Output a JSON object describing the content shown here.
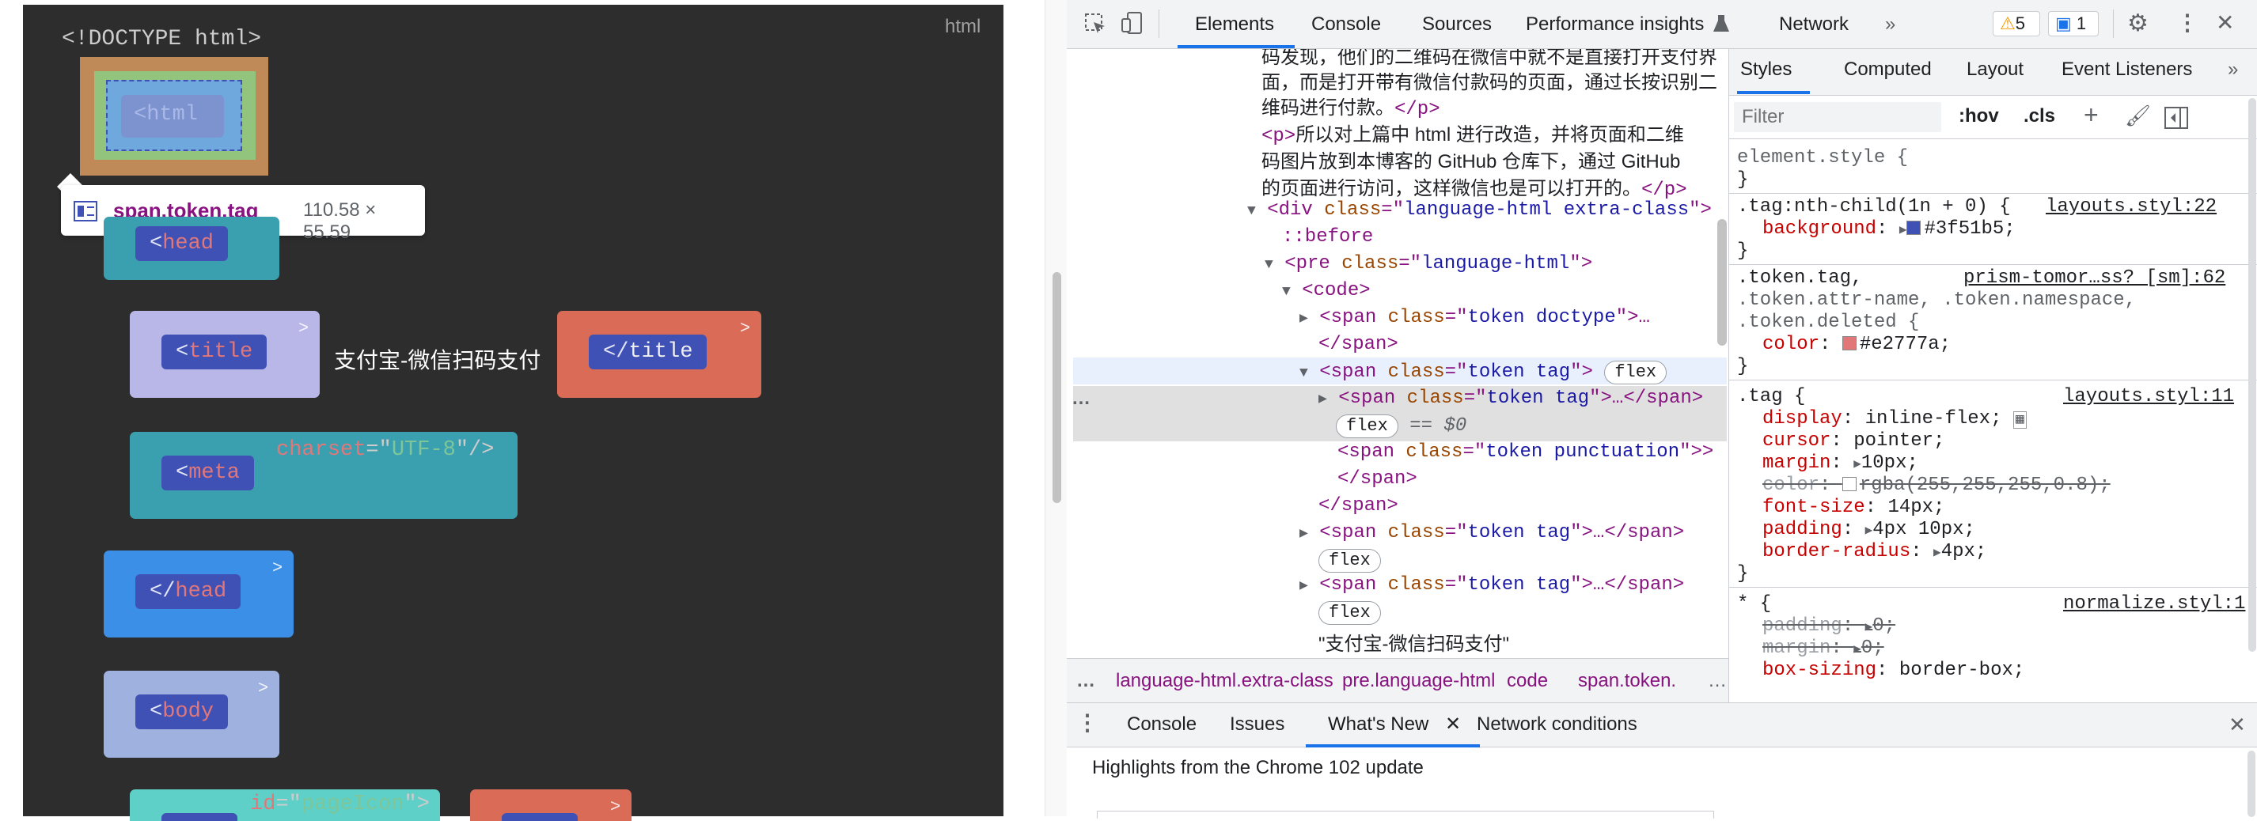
{
  "page": {
    "doctype_text": "<!DOCTYPE html>",
    "lang_label": "html",
    "tooltip": {
      "selector": "span.token.tag",
      "size": "110.58 × 55.59"
    },
    "html_tag": "<html",
    "rows": [
      {
        "open": "<",
        "name": "head",
        "caret": ">"
      },
      {
        "open": "<",
        "name": "title",
        "caret": ">"
      },
      {
        "text": "支付宝-微信扫码支付"
      },
      {
        "open": "</",
        "name": "title",
        "caret": ">"
      },
      {
        "open": "<",
        "name": "meta",
        "attr_name": "charset",
        "attr_eq": "=\"",
        "attr_val": "UTF-8",
        "attr_close": "\"/>"
      },
      {
        "open": "</",
        "name": "head",
        "caret": ">"
      },
      {
        "open": "<",
        "name": "body",
        "caret": ">"
      },
      {
        "attr_name": "id",
        "attr_eq": "=\"",
        "attr_val": "pageIcon",
        "attr_close": "\">"
      },
      {
        "caret": ">"
      }
    ]
  },
  "devtools": {
    "tabs": [
      "Elements",
      "Console",
      "Sources",
      "Performance insights",
      "Network"
    ],
    "more": "»",
    "warn_count": "5",
    "info_count": "1",
    "elements_lines": {
      "l1": "码发现，他们的二维码在微信中就不是直接打开支付界",
      "l2": "面，而是打开带有微信付款码的页面，通过长按识别二",
      "l3a": "维码进行付款。",
      "l3b": "</p>",
      "l4a": "<p>",
      "l4b": "所以对上篇中 html 进行改造，并将页面和二维",
      "l5": "码图片放到本博客的 GitHub 仓库下，通过 GitHub",
      "l6a": "的页面进行访问，这样微信也是可以打开的。",
      "l6b": "</p>",
      "div_open": "<div ",
      "div_attr": "class",
      "div_eq": "=\"",
      "div_val": "language-html extra-class",
      "div_close": "\">",
      "before": "::before",
      "pre_open": "<pre ",
      "pre_attr": "class",
      "pre_val": "language-html",
      "code": "<code>",
      "span_open": "<span ",
      "span_attr": "class",
      "doctype_val": "token doctype",
      "span_ellipsis": "\">…",
      "span_close": "</span>",
      "tag_val": "token tag",
      "flex": "flex",
      "eq_dollar": "== $0",
      "punc_val": "token punctuation",
      "close_gtgt": "\">>",
      "span_ell_close": "\">…</span>",
      "text_node": "\"支付宝-微信扫码支付\"",
      "dots": "…"
    },
    "breadcrumbs": [
      "…",
      "language-html.extra-class",
      "pre.language-html",
      "code",
      "span.token.",
      "…"
    ],
    "sidebar_tabs": [
      "Styles",
      "Computed",
      "Layout",
      "Event Listeners",
      "»"
    ],
    "filter_placeholder": "Filter",
    "hov": ":hov",
    "cls": ".cls",
    "plus": "+",
    "rules": {
      "element_style": "element.style {",
      "close": "}",
      "r1_sel": ".tag:nth-child(1n + 0) {",
      "r1_src": "layouts.styl:22",
      "r1_prop": "background",
      "r1_val": "#3f51b5;",
      "r2_sel": ".token.tag,",
      "r2_src": "prism-tomor…ss? [sm]:62",
      "r2_sel2": ".token.attr-name, .token.namespace,",
      "r2_sel3": ".token.deleted {",
      "r2_prop": "color",
      "r2_val": "#e2777a;",
      "r3_sel": ".tag {",
      "r3_src": "layouts.styl:11",
      "r3_p1": "display",
      "r3_v1": "inline-flex;",
      "r3_p2": "cursor",
      "r3_v2": "pointer;",
      "r3_p3": "margin",
      "r3_v3": "10px;",
      "r3_p4": "color",
      "r3_v4": "rgba(255,255,255,0.8);",
      "r3_p5": "font-size",
      "r3_v5": "14px;",
      "r3_p6": "padding",
      "r3_v6": "4px 10px;",
      "r3_p7": "border-radius",
      "r3_v7": "4px;",
      "r4_sel": "* {",
      "r4_src": "normalize.styl:1",
      "r4_p1": "padding",
      "r4_v1": "0;",
      "r4_p2": "margin",
      "r4_v2": "0;",
      "r4_p3": "box-sizing",
      "r4_v3": "border-box;"
    },
    "colors": {
      "bg_swatch": "#3f51b5",
      "color_swatch": "#e2777a"
    },
    "drawer": {
      "tabs": [
        "Console",
        "Issues",
        "What's New",
        "Network conditions"
      ],
      "highlight": "Highlights from the Chrome 102 update"
    }
  }
}
